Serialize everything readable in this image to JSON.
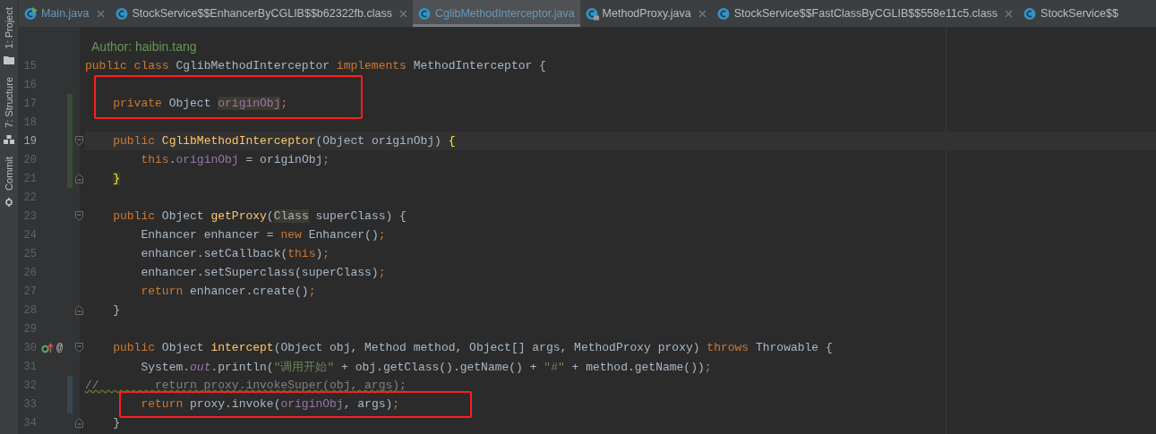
{
  "side_tools": [
    {
      "label": "1: Project"
    },
    {
      "label": "7: Structure"
    },
    {
      "label": "Commit"
    }
  ],
  "tabs": [
    {
      "label": "Main.java",
      "kind": "run",
      "selected": false,
      "closable": true
    },
    {
      "label": "StockService$$EnhancerByCGLIB$$b62322fb.class",
      "kind": "class",
      "selected": false,
      "closable": true
    },
    {
      "label": "CglibMethodInterceptor.java",
      "kind": "class",
      "selected": true,
      "closable": false
    },
    {
      "label": "MethodProxy.java",
      "kind": "locked",
      "selected": false,
      "closable": true
    },
    {
      "label": "StockService$$FastClassByCGLIB$$558e11c5.class",
      "kind": "class",
      "selected": false,
      "closable": true
    },
    {
      "label": "StockService$$",
      "kind": "class",
      "selected": false,
      "closable": false
    }
  ],
  "lines": [
    {
      "tokens": [
        {
          "kind": "doc",
          "t": "  Author: haibin.tang"
        }
      ]
    },
    {
      "number": "15",
      "tokens": [
        {
          "kind": "kw",
          "t": "public class "
        },
        {
          "kind": "plain",
          "t": "CglibMethodInterceptor "
        },
        {
          "kind": "kw",
          "t": "implements "
        },
        {
          "kind": "plain",
          "t": "MethodInterceptor {"
        }
      ]
    },
    {
      "number": "16"
    },
    {
      "number": "17",
      "added": true,
      "boxed": true,
      "tokens": [
        {
          "kind": "kw",
          "t": "    private "
        },
        {
          "kind": "plain",
          "t": "Object "
        },
        {
          "kind": "field",
          "t": "originObj",
          "hl": true
        },
        {
          "kind": "kw",
          "t": ";"
        }
      ]
    },
    {
      "number": "18",
      "added": true
    },
    {
      "number": "19",
      "added": true,
      "current": true,
      "fold_start": true,
      "tokens": [
        {
          "kind": "kw",
          "t": "    public "
        },
        {
          "kind": "fn",
          "t": "CglibMethodInterceptor"
        },
        {
          "kind": "plain",
          "t": "(Object originObj) "
        },
        {
          "kind": "match",
          "t": "{"
        }
      ]
    },
    {
      "number": "20",
      "added": true,
      "tokens": [
        {
          "kind": "kw",
          "t": "        this"
        },
        {
          "kind": "plain",
          "t": "."
        },
        {
          "kind": "field",
          "t": "originObj"
        },
        {
          "kind": "plain",
          "t": " = originObj"
        },
        {
          "kind": "kw",
          "t": ";"
        }
      ]
    },
    {
      "number": "21",
      "added": true,
      "fold_end": true,
      "tokens": [
        {
          "kind": "match",
          "t": "    }",
          "hl": true
        }
      ]
    },
    {
      "number": "22"
    },
    {
      "number": "23",
      "fold_start": true,
      "tokens": [
        {
          "kind": "kw",
          "t": "    public "
        },
        {
          "kind": "plain",
          "t": "Object "
        },
        {
          "kind": "fn",
          "t": "getProxy"
        },
        {
          "kind": "plain",
          "t": "("
        },
        {
          "kind": "plain",
          "t": "Class",
          "hl": true
        },
        {
          "kind": "plain",
          "t": " superClass) {"
        }
      ]
    },
    {
      "number": "24",
      "tokens": [
        {
          "kind": "plain",
          "t": "        Enhancer enhancer = "
        },
        {
          "kind": "kw",
          "t": "new "
        },
        {
          "kind": "plain",
          "t": "Enhancer()"
        },
        {
          "kind": "kw",
          "t": ";"
        }
      ]
    },
    {
      "number": "25",
      "tokens": [
        {
          "kind": "plain",
          "t": "        enhancer.setCallback("
        },
        {
          "kind": "kw",
          "t": "this"
        },
        {
          "kind": "plain",
          "t": ")"
        },
        {
          "kind": "kw",
          "t": ";"
        }
      ]
    },
    {
      "number": "26",
      "tokens": [
        {
          "kind": "plain",
          "t": "        enhancer.setSuperclass(superClass)"
        },
        {
          "kind": "kw",
          "t": ";"
        }
      ]
    },
    {
      "number": "27",
      "tokens": [
        {
          "kind": "kw",
          "t": "        return "
        },
        {
          "kind": "plain",
          "t": "enhancer.create()"
        },
        {
          "kind": "kw",
          "t": ";"
        }
      ]
    },
    {
      "number": "28",
      "fold_end": true,
      "tokens": [
        {
          "kind": "plain",
          "t": "    }"
        }
      ]
    },
    {
      "number": "29"
    },
    {
      "number": "30",
      "override": true,
      "gutter_text": "@",
      "fold_start": true,
      "tokens": [
        {
          "kind": "kw",
          "t": "    public "
        },
        {
          "kind": "plain",
          "t": "Object "
        },
        {
          "kind": "fn",
          "t": "intercept"
        },
        {
          "kind": "plain",
          "t": "(Object obj, Method method, Object[] args, MethodProxy proxy) "
        },
        {
          "kind": "kw",
          "t": "throws "
        },
        {
          "kind": "plain",
          "t": "Throwable {"
        }
      ]
    },
    {
      "number": "31",
      "tokens": [
        {
          "kind": "plain",
          "t": "        System."
        },
        {
          "kind": "static",
          "t": "out"
        },
        {
          "kind": "plain",
          "t": ".println("
        },
        {
          "kind": "str",
          "t": "\"调用开始\""
        },
        {
          "kind": "plain",
          "t": " + obj.getClass().getName() + "
        },
        {
          "kind": "str",
          "t": "\"#\""
        },
        {
          "kind": "plain",
          "t": " + method.getName())"
        },
        {
          "kind": "kw",
          "t": ";"
        }
      ]
    },
    {
      "number": "32",
      "modified": true,
      "tokens": [
        {
          "kind": "comment",
          "t": "//        return proxy.invokeSuper(obj, args);"
        }
      ]
    },
    {
      "number": "33",
      "modified": true,
      "boxed": true,
      "tokens": [
        {
          "kind": "kw",
          "t": "        return "
        },
        {
          "kind": "plain",
          "t": "proxy.invoke("
        },
        {
          "kind": "field",
          "t": "originObj"
        },
        {
          "kind": "plain",
          "t": ", args)"
        },
        {
          "kind": "kw",
          "t": ";"
        }
      ]
    },
    {
      "number": "34",
      "fold_end": true,
      "tokens": [
        {
          "kind": "plain",
          "t": "    }"
        }
      ]
    }
  ]
}
